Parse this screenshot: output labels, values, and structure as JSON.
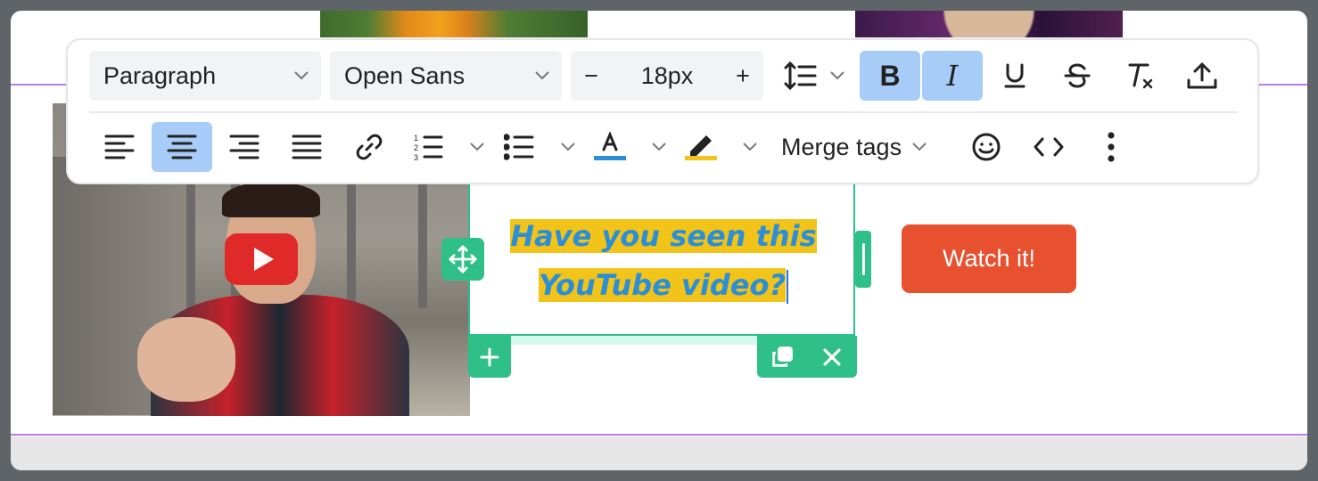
{
  "toolbar": {
    "block_format": "Paragraph",
    "font_family": "Open Sans",
    "font_size": "18px",
    "decrease_symbol": "−",
    "increase_symbol": "+",
    "merge_tags": "Merge tags",
    "text_color": "#2b8fd8",
    "highlight_color": "#f2c318",
    "active": [
      "bold",
      "italic",
      "align-center"
    ]
  },
  "content": {
    "heading_line1": "Have you seen this",
    "heading_line2": "YouTube video?",
    "watch_button": "Watch it!"
  },
  "colors": {
    "accent_green": "#2fbf88",
    "active_blue": "#a7ccf7",
    "button_orange": "#e8512f",
    "row_outline_purple": "#b57be6"
  }
}
